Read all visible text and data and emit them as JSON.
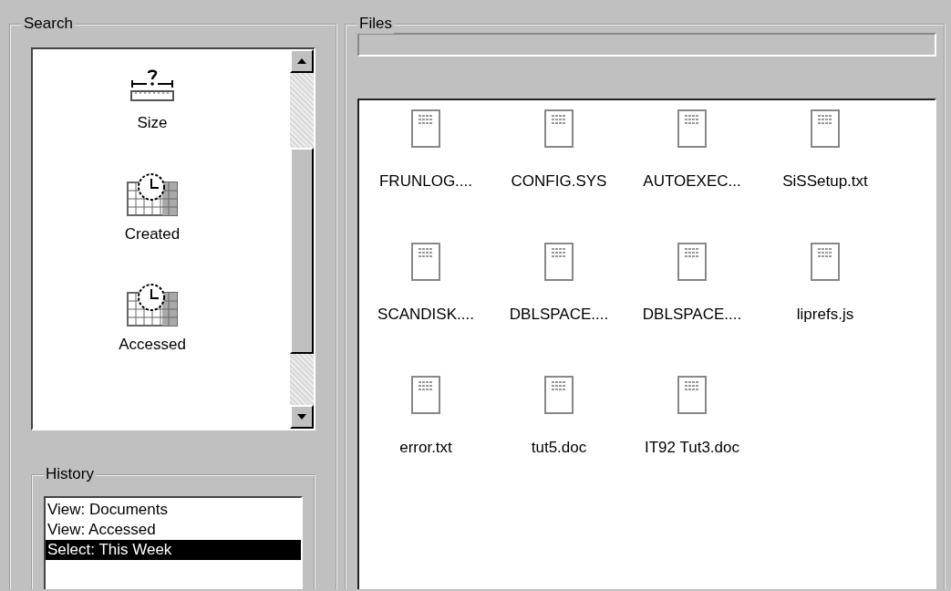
{
  "search": {
    "title": "Search",
    "items": [
      {
        "kind": "size",
        "label": "Size"
      },
      {
        "kind": "calendar",
        "label": "Created"
      },
      {
        "kind": "calendar",
        "label": "Accessed"
      }
    ]
  },
  "history": {
    "title": "History",
    "items": [
      {
        "label": "View: Documents",
        "selected": false
      },
      {
        "label": "View: Accessed",
        "selected": false
      },
      {
        "label": "Select: This Week",
        "selected": true
      }
    ]
  },
  "files": {
    "title": "Files",
    "items": [
      {
        "name": "FRUNLOG...."
      },
      {
        "name": "CONFIG.SYS"
      },
      {
        "name": "AUTOEXEC..."
      },
      {
        "name": "SiSSetup.txt"
      },
      {
        "name": "SCANDISK...."
      },
      {
        "name": "DBLSPACE...."
      },
      {
        "name": "DBLSPACE...."
      },
      {
        "name": "liprefs.js"
      },
      {
        "name": "error.txt"
      },
      {
        "name": "tut5.doc"
      },
      {
        "name": "IT92 Tut3.doc"
      }
    ]
  }
}
